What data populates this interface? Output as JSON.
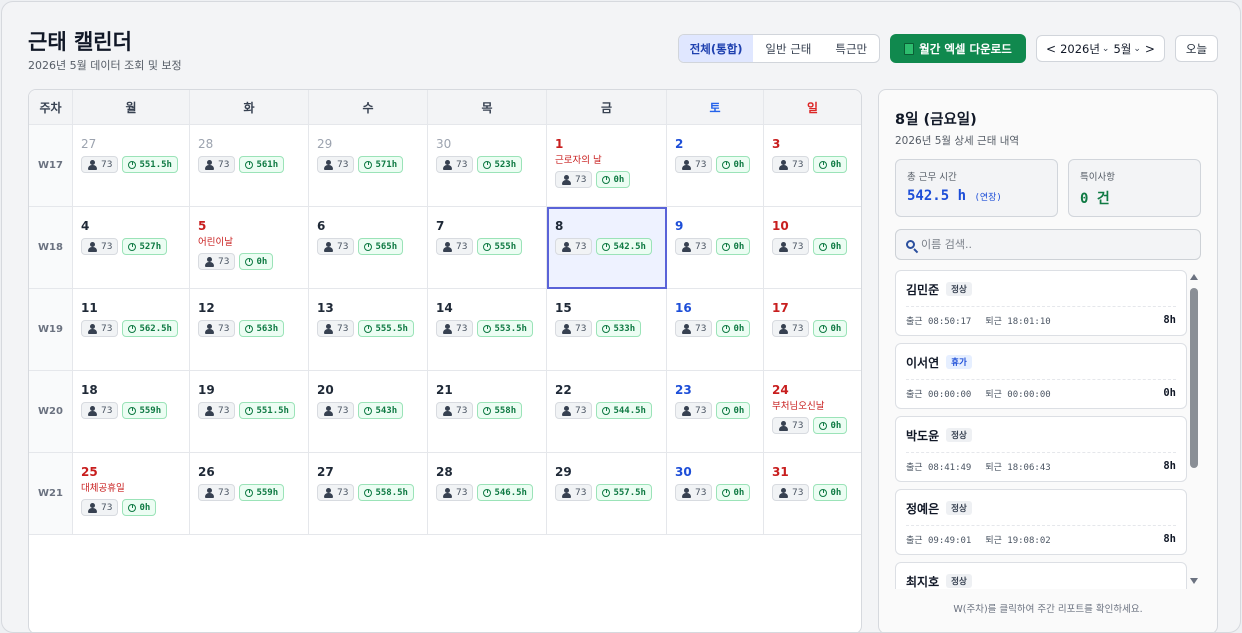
{
  "header": {
    "title": "근태 캘린더",
    "subtitle": "2026년 5월 데이터 조회 및 보정"
  },
  "filter": {
    "options": [
      "전체(통합)",
      "일반 근태",
      "특근만"
    ],
    "active_index": 0
  },
  "download_label": "월간 엑셀 다운로드",
  "month_nav": {
    "prev": "<",
    "year": "2026년",
    "month": "5월",
    "next": ">"
  },
  "today_label": "오늘",
  "calendar": {
    "headers": [
      "주차",
      "월",
      "화",
      "수",
      "목",
      "금",
      "토",
      "일"
    ],
    "weeks": [
      {
        "label": "W17",
        "days": [
          {
            "day": "27",
            "other": true,
            "people": "73",
            "hours": "551.5h"
          },
          {
            "day": "28",
            "other": true,
            "people": "73",
            "hours": "561h"
          },
          {
            "day": "29",
            "other": true,
            "people": "73",
            "hours": "571h"
          },
          {
            "day": "30",
            "other": true,
            "people": "73",
            "hours": "523h"
          },
          {
            "day": "1",
            "holiday": "근로자의 날",
            "people": "73",
            "hours": "0h"
          },
          {
            "day": "2",
            "people": "73",
            "hours": "0h"
          },
          {
            "day": "3",
            "people": "73",
            "hours": "0h"
          }
        ]
      },
      {
        "label": "W18",
        "days": [
          {
            "day": "4",
            "people": "73",
            "hours": "527h"
          },
          {
            "day": "5",
            "holiday": "어린이날",
            "people": "73",
            "hours": "0h"
          },
          {
            "day": "6",
            "people": "73",
            "hours": "565h"
          },
          {
            "day": "7",
            "people": "73",
            "hours": "555h"
          },
          {
            "day": "8",
            "selected": true,
            "people": "73",
            "hours": "542.5h"
          },
          {
            "day": "9",
            "people": "73",
            "hours": "0h"
          },
          {
            "day": "10",
            "people": "73",
            "hours": "0h"
          }
        ]
      },
      {
        "label": "W19",
        "days": [
          {
            "day": "11",
            "people": "73",
            "hours": "562.5h"
          },
          {
            "day": "12",
            "people": "73",
            "hours": "563h"
          },
          {
            "day": "13",
            "people": "73",
            "hours": "555.5h"
          },
          {
            "day": "14",
            "people": "73",
            "hours": "553.5h"
          },
          {
            "day": "15",
            "people": "73",
            "hours": "533h"
          },
          {
            "day": "16",
            "people": "73",
            "hours": "0h"
          },
          {
            "day": "17",
            "people": "73",
            "hours": "0h"
          }
        ]
      },
      {
        "label": "W20",
        "days": [
          {
            "day": "18",
            "people": "73",
            "hours": "559h"
          },
          {
            "day": "19",
            "people": "73",
            "hours": "551.5h"
          },
          {
            "day": "20",
            "people": "73",
            "hours": "543h"
          },
          {
            "day": "21",
            "people": "73",
            "hours": "558h"
          },
          {
            "day": "22",
            "people": "73",
            "hours": "544.5h"
          },
          {
            "day": "23",
            "people": "73",
            "hours": "0h"
          },
          {
            "day": "24",
            "holiday": "부처님오신날",
            "people": "73",
            "hours": "0h"
          }
        ]
      },
      {
        "label": "W21",
        "days": [
          {
            "day": "25",
            "holiday": "대체공휴일",
            "people": "73",
            "hours": "0h"
          },
          {
            "day": "26",
            "people": "73",
            "hours": "559h"
          },
          {
            "day": "27",
            "people": "73",
            "hours": "558.5h"
          },
          {
            "day": "28",
            "people": "73",
            "hours": "546.5h"
          },
          {
            "day": "29",
            "people": "73",
            "hours": "557.5h"
          },
          {
            "day": "30",
            "people": "73",
            "hours": "0h"
          },
          {
            "day": "31",
            "people": "73",
            "hours": "0h"
          }
        ]
      }
    ]
  },
  "detail": {
    "title": "8일 (금요일)",
    "subtitle": "2026년 5월 상세 근태 내역",
    "total_label": "총 근무 시간",
    "total_value": "542.5 h",
    "total_note": "(연장)",
    "special_label": "특이사항",
    "special_value": "0 건",
    "search_placeholder": "이름 검색..",
    "employees": [
      {
        "name": "김민준",
        "status": "정상",
        "in": "출근 08:50:17",
        "out": "퇴근 18:01:10",
        "hours": "8h"
      },
      {
        "name": "이서연",
        "status": "휴가",
        "in": "출근 00:00:00",
        "out": "퇴근 00:00:00",
        "hours": "0h"
      },
      {
        "name": "박도윤",
        "status": "정상",
        "in": "출근 08:41:49",
        "out": "퇴근 18:06:43",
        "hours": "8h"
      },
      {
        "name": "정예은",
        "status": "정상",
        "in": "출근 09:49:01",
        "out": "퇴근 19:08:02",
        "hours": "8h"
      },
      {
        "name": "최지호",
        "status": "정상",
        "in": "",
        "out": "",
        "hours": ""
      }
    ],
    "footer": "W(주차)를 클릭하여 주간 리포트를 확인하세요."
  },
  "colors": {
    "accent": "#10894e",
    "saturday": "#1d4ed8",
    "sunday": "#c81e1e",
    "selected": "#5a63d8"
  }
}
